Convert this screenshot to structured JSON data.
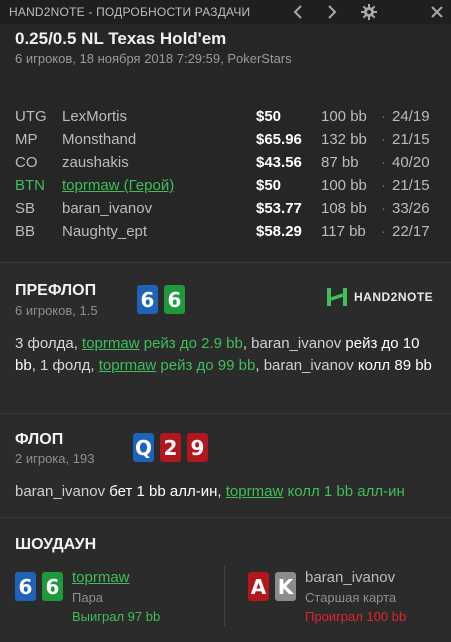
{
  "titlebar": {
    "title": "HAND2NOTE - ПОДРОБНОСТИ РАЗДАЧИ",
    "icons": [
      "chevron-left-icon",
      "chevron-right-icon",
      "gear-icon",
      "close-icon"
    ]
  },
  "hand": {
    "title": "0.25/0.5 NL Texas Hold'em",
    "subtitle": "6 игроков, 18 ноября 2018 7:29:59, PokerStars"
  },
  "players": [
    {
      "pos": "UTG",
      "name": "LexMortis",
      "stack": "$50",
      "bb": "100 bb",
      "sep": "·",
      "vpip": "24/19"
    },
    {
      "pos": "MP",
      "name": "Monsthand",
      "stack": "$65.96",
      "bb": "132 bb",
      "sep": "·",
      "vpip": "21/15"
    },
    {
      "pos": "CO",
      "name": "zaushakis",
      "stack": "$43.56",
      "bb": "87 bb",
      "sep": "·",
      "vpip": "40/20"
    },
    {
      "pos": "BTN",
      "name": "toprmaw (Герой)",
      "stack": "$50",
      "bb": "100 bb",
      "sep": "·",
      "vpip": "21/15"
    },
    {
      "pos": "SB",
      "name": "baran_ivanov",
      "stack": "$53.77",
      "bb": "108 bb",
      "sep": "·",
      "vpip": "33/26"
    },
    {
      "pos": "BB",
      "name": "Naughty_ept",
      "stack": "$58.29",
      "bb": "117 bb",
      "sep": "·",
      "vpip": "22/17"
    }
  ],
  "preflop": {
    "title": "ПРЕФЛОП",
    "subtitle": "6 игроков, 1.5",
    "cards": [
      "6",
      "6"
    ],
    "logo": "HAND2NOTE",
    "a1": "3 фолда, ",
    "a2": "toprmaw",
    "a3": " рейз до 2.9 bb",
    "a4": ", ",
    "a5": "baran_ivanov",
    "a6": " рейз до 10 bb",
    "a7": ", 1 фолд, ",
    "a8": "toprmaw",
    "a9": " рейз до 99 bb",
    "a10": ", ",
    "a11": "baran_ivanov",
    "a12": " колл 89 bb"
  },
  "flop": {
    "title": "ФЛОП",
    "subtitle": "2 игрока, 193",
    "cards": [
      "Q",
      "2",
      "9"
    ],
    "a1": "baran_ivanov",
    "a2": " бет 1 bb алл-ин",
    "a3": ", ",
    "a4": "toprmaw",
    "a5": " колл 1 bb алл-ин"
  },
  "showdown": {
    "title": "ШОУДАУН",
    "hero": {
      "cards": [
        "6",
        "6"
      ],
      "name": "toprmaw",
      "hand": "Пара",
      "result": "Выиграл 97 bb"
    },
    "villain": {
      "cards": [
        "A",
        "K"
      ],
      "name": "baran_ivanov",
      "hand": "Старшая карта",
      "result": "Проиграл 100 bb"
    }
  },
  "colors": {
    "hero_green": "#3fbe5a",
    "loss_red": "#e0242b",
    "card_blue": "#1f63b8",
    "card_green": "#1e9a3c",
    "card_red": "#b3171d",
    "card_grey": "#8c8c8c"
  }
}
